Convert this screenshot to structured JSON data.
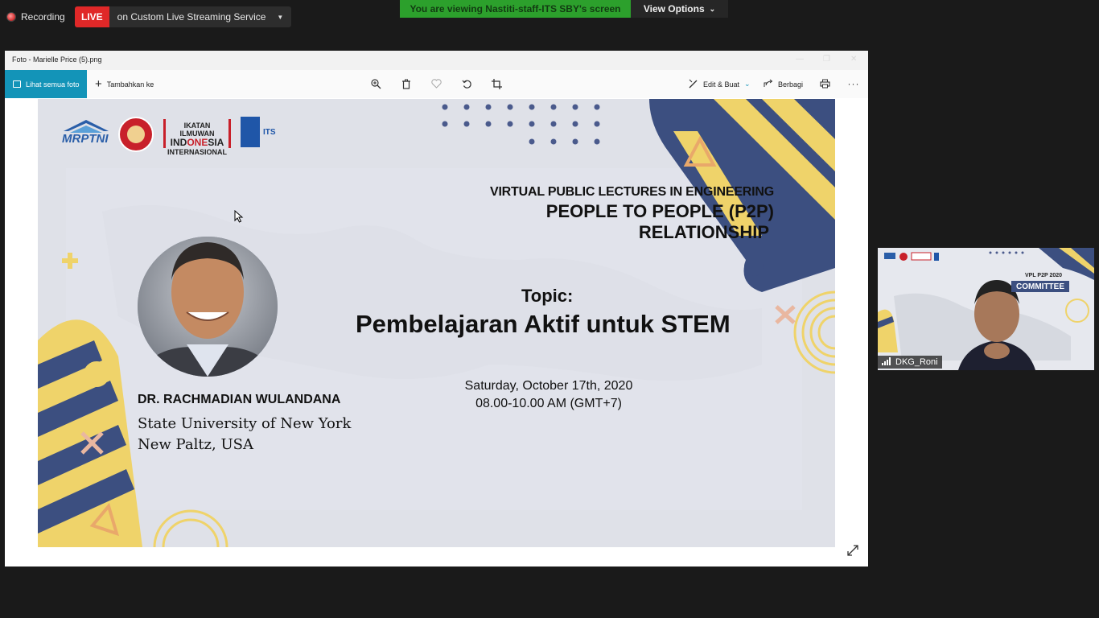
{
  "topbar": {
    "recording_label": "Recording",
    "live_badge": "LIVE",
    "live_service": "on Custom Live Streaming Service",
    "viewing_banner": "You are viewing Nastiti-staff-ITS SBY's screen",
    "view_options": "View Options"
  },
  "window": {
    "title": "Foto - Marielle Price (5).png",
    "toolbar": {
      "all_photos": "Lihat semua foto",
      "add_to": "Tambahkan ke",
      "edit_create": "Edit & Buat",
      "share": "Berbagi"
    }
  },
  "slide": {
    "logos": [
      "MRPTNI",
      "Garuda",
      "IKATAN ILMUWAN INDONESIA INTERNASIONAL",
      "ITS"
    ],
    "logo_text": {
      "mrptni": "MRPTNI",
      "ikatan_1": "IKATAN ILMUWAN",
      "ikatan_2a": "IND",
      "ikatan_2b": "ONE",
      "ikatan_2c": "SIA",
      "ikatan_3": "INTERNASIONAL",
      "its": "ITS"
    },
    "lecture_series": "VIRTUAL PUBLIC LECTURES IN ENGINEERING",
    "lecture_title_1": "PEOPLE TO PEOPLE (P2P)",
    "lecture_title_2": "RELATIONSHIP",
    "topic_label": "Topic:",
    "topic": "Pembelajaran Aktif untuk STEM",
    "date": "Saturday, October 17th, 2020",
    "time": "08.00-10.00 AM (GMT+7)",
    "speaker": "DR. RACHMADIAN WULANDANA",
    "affiliation_1": "State University of New York",
    "affiliation_2": "New Paltz, USA"
  },
  "participant": {
    "name": "DKG_Roni",
    "banner_1": "VPL P2P 2020",
    "banner_2": "COMMITTEE"
  },
  "colors": {
    "live_red": "#e02828",
    "viewing_green": "#2ca02c",
    "photos_accent": "#1394b8",
    "slide_navy": "#3c4f80",
    "slide_yellow": "#efd36a",
    "slide_orange": "#e9a86a"
  }
}
